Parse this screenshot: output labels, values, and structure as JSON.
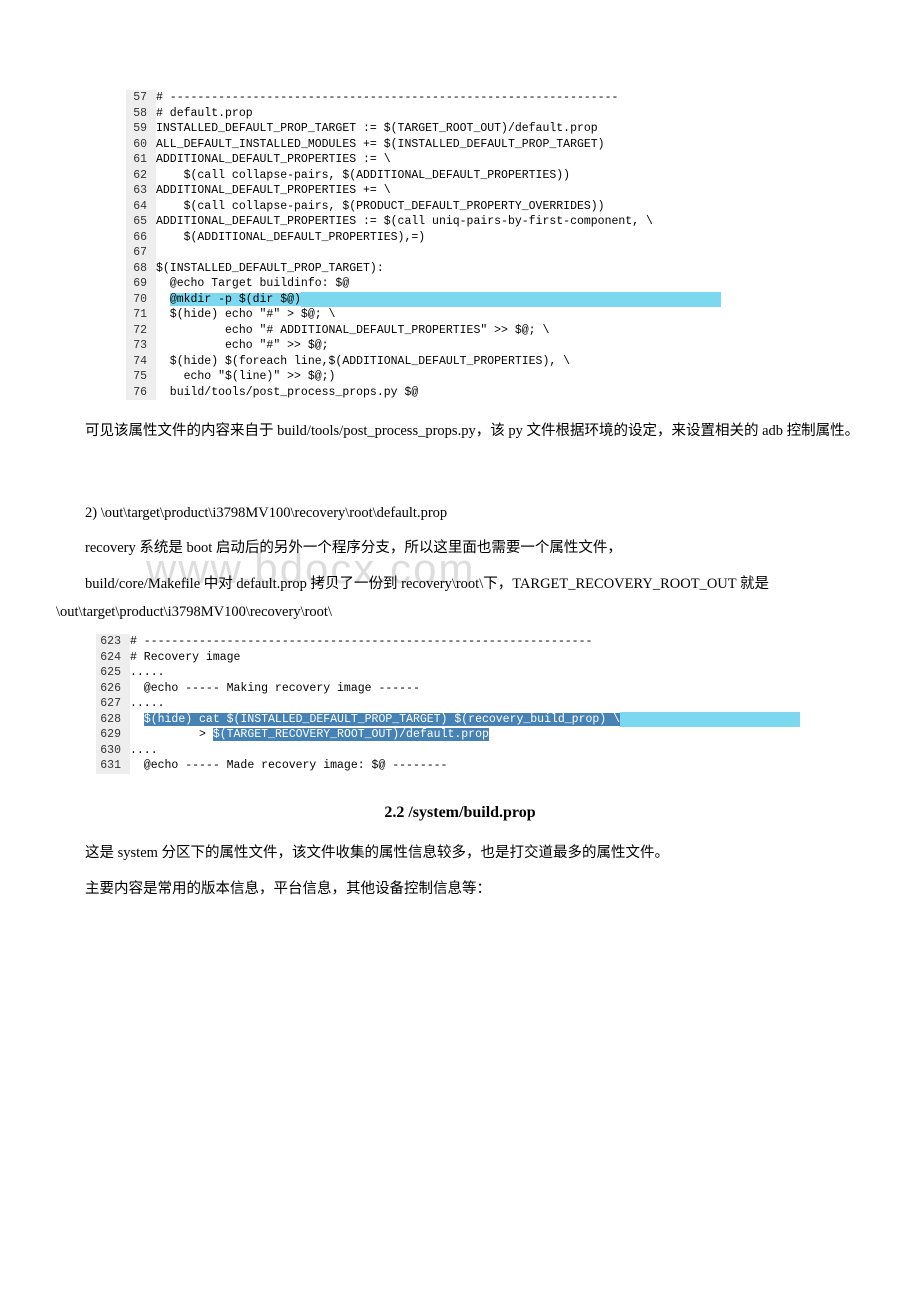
{
  "code1": {
    "lines": [
      {
        "n": "57",
        "t": "# -----------------------------------------------------------------"
      },
      {
        "n": "58",
        "t": "# default.prop"
      },
      {
        "n": "59",
        "t": "INSTALLED_DEFAULT_PROP_TARGET := $(TARGET_ROOT_OUT)/default.prop"
      },
      {
        "n": "60",
        "t": "ALL_DEFAULT_INSTALLED_MODULES += $(INSTALLED_DEFAULT_PROP_TARGET)"
      },
      {
        "n": "61",
        "t": "ADDITIONAL_DEFAULT_PROPERTIES := \\"
      },
      {
        "n": "62",
        "t": "    $(call collapse-pairs, $(ADDITIONAL_DEFAULT_PROPERTIES))"
      },
      {
        "n": "63",
        "t": "ADDITIONAL_DEFAULT_PROPERTIES += \\"
      },
      {
        "n": "64",
        "t": "    $(call collapse-pairs, $(PRODUCT_DEFAULT_PROPERTY_OVERRIDES))"
      },
      {
        "n": "65",
        "t": "ADDITIONAL_DEFAULT_PROPERTIES := $(call uniq-pairs-by-first-component, \\"
      },
      {
        "n": "66",
        "t": "    $(ADDITIONAL_DEFAULT_PROPERTIES),=)"
      },
      {
        "n": "67",
        "t": ""
      },
      {
        "n": "68",
        "t": "$(INSTALLED_DEFAULT_PROP_TARGET):"
      },
      {
        "n": "69",
        "t": "  @echo Target buildinfo: $@"
      },
      {
        "n": "70",
        "pre": "  ",
        "hl": "@mkdir -p $(dir $@)",
        "hlrest": true
      },
      {
        "n": "71",
        "t": "  $(hide) echo \"#\" > $@; \\"
      },
      {
        "n": "72",
        "t": "          echo \"# ADDITIONAL_DEFAULT_PROPERTIES\" >> $@; \\"
      },
      {
        "n": "73",
        "t": "          echo \"#\" >> $@;"
      },
      {
        "n": "74",
        "t": "  $(hide) $(foreach line,$(ADDITIONAL_DEFAULT_PROPERTIES), \\"
      },
      {
        "n": "75",
        "t": "    echo \"$(line)\" >> $@;)"
      },
      {
        "n": "76",
        "t": "  build/tools/post_process_props.py $@"
      }
    ]
  },
  "p1": "可见该属性文件的内容来自于 build/tools/post_process_props.py，该 py 文件根据环境的设定，来设置相关的 adb 控制属性。",
  "p2": "2) \\out\\target\\product\\i3798MV100\\recovery\\root\\default.prop",
  "p3": "recovery 系统是 boot 启动后的另外一个程序分支，所以这里面也需要一个属性文件，",
  "p4": "build/core/Makefile 中对 default.prop 拷贝了一份到 recovery\\root\\下，TARGET_RECOVERY_ROOT_OUT 就是\\out\\target\\product\\i3798MV100\\recovery\\root\\",
  "code2": {
    "lines": [
      {
        "n": "623",
        "t": "# -----------------------------------------------------------------"
      },
      {
        "n": "624",
        "t": "# Recovery image"
      },
      {
        "n": "625",
        "t": "....."
      },
      {
        "n": "626",
        "t": "  @echo ----- Making recovery image ------"
      },
      {
        "n": "627",
        "t": "....."
      },
      {
        "n": "628",
        "pre": "  ",
        "hl": "$(hide) cat $(INSTALLED_DEFAULT_PROP_TARGET) $(recovery_build_prop) \\",
        "style": "dark",
        "hlrest": true
      },
      {
        "n": "629",
        "pre": "          > ",
        "hl": "$(TARGET_RECOVERY_ROOT_OUT)/default.prop",
        "style": "dark"
      },
      {
        "n": "630",
        "t": "...."
      },
      {
        "n": "631",
        "t": "  @echo ----- Made recovery image: $@ --------"
      }
    ]
  },
  "h1": "2.2 /system/build.prop",
  "p5": "这是 system 分区下的属性文件，该文件收集的属性信息较多，也是打交道最多的属性文件。",
  "p6": "主要内容是常用的版本信息，平台信息，其他设备控制信息等：",
  "watermark": "www.bdocx.com"
}
